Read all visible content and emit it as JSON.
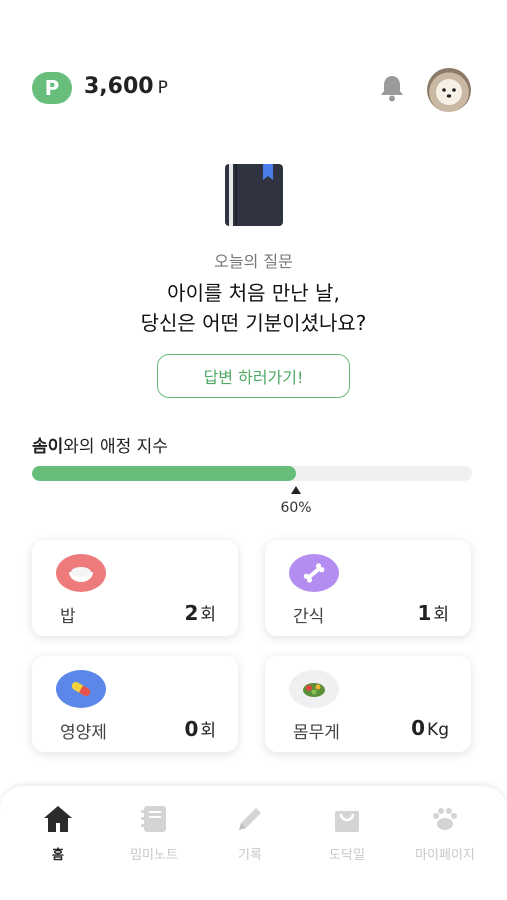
{
  "header": {
    "point_badge": "P",
    "points": "3,600",
    "points_unit": "P",
    "bell_icon": "bell-icon",
    "avatar": "avatar"
  },
  "question": {
    "label": "오늘의 질문",
    "line1": "아이를 처음 만난 날,",
    "line2": "당신은 어떤 기분이셨나요?",
    "answer_button": "답변 하러가기!"
  },
  "affection": {
    "name": "솜이",
    "title_suffix": "와의 애정 지수",
    "progress": 0.6,
    "percent_label": "60%",
    "color": "#67bd7a"
  },
  "stats": [
    {
      "icon": "rice-bowl-icon",
      "label": "밥",
      "value": "2",
      "unit": "회",
      "icon_bg": "#ee7b7b"
    },
    {
      "icon": "bone-icon",
      "label": "간식",
      "value": "1",
      "unit": "회",
      "icon_bg": "#b38ef0"
    },
    {
      "icon": "pill-icon",
      "label": "영양제",
      "value": "0",
      "unit": "회",
      "icon_bg": "#5b86ea"
    },
    {
      "icon": "salad-icon",
      "label": "몸무게",
      "value": "0",
      "unit": "Kg",
      "icon_bg": "#f0f0f0"
    }
  ],
  "nav": [
    {
      "icon": "home-icon",
      "label": "홈",
      "active": true
    },
    {
      "icon": "notebook-icon",
      "label": "밈미노트",
      "active": false
    },
    {
      "icon": "pencil-icon",
      "label": "기록",
      "active": false
    },
    {
      "icon": "shopping-bag-icon",
      "label": "도닥밀",
      "active": false
    },
    {
      "icon": "paw-icon",
      "label": "마이페이지",
      "active": false
    }
  ]
}
